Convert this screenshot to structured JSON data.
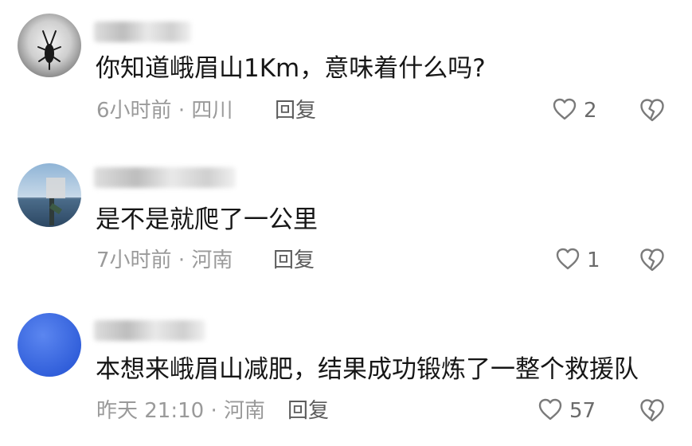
{
  "comments": [
    {
      "text": "你知道峨眉山1Km，意味着什么吗?",
      "time": "6小时前",
      "location": "四川",
      "reply_label": "回复",
      "likes": "2",
      "like_icon": "heart-outline-icon",
      "dislike_icon": "broken-heart-icon"
    },
    {
      "text": "是不是就爬了一公里",
      "time": "7小时前",
      "location": "河南",
      "reply_label": "回复",
      "likes": "1",
      "like_icon": "heart-outline-icon",
      "dislike_icon": "broken-heart-icon"
    },
    {
      "text": "本想来峨眉山减肥，结果成功锻炼了一整个救援队",
      "time": "昨天 21:10",
      "location": "河南",
      "reply_label": "回复",
      "likes": "57",
      "like_icon": "heart-outline-icon",
      "dislike_icon": "broken-heart-icon"
    }
  ],
  "meta_separator": "·",
  "colors": {
    "text": "#161616",
    "meta": "#9a9a9a",
    "reply": "#5c5c5c",
    "icon": "#7a7a7a",
    "avatar_blue": "#3d6fe6"
  }
}
